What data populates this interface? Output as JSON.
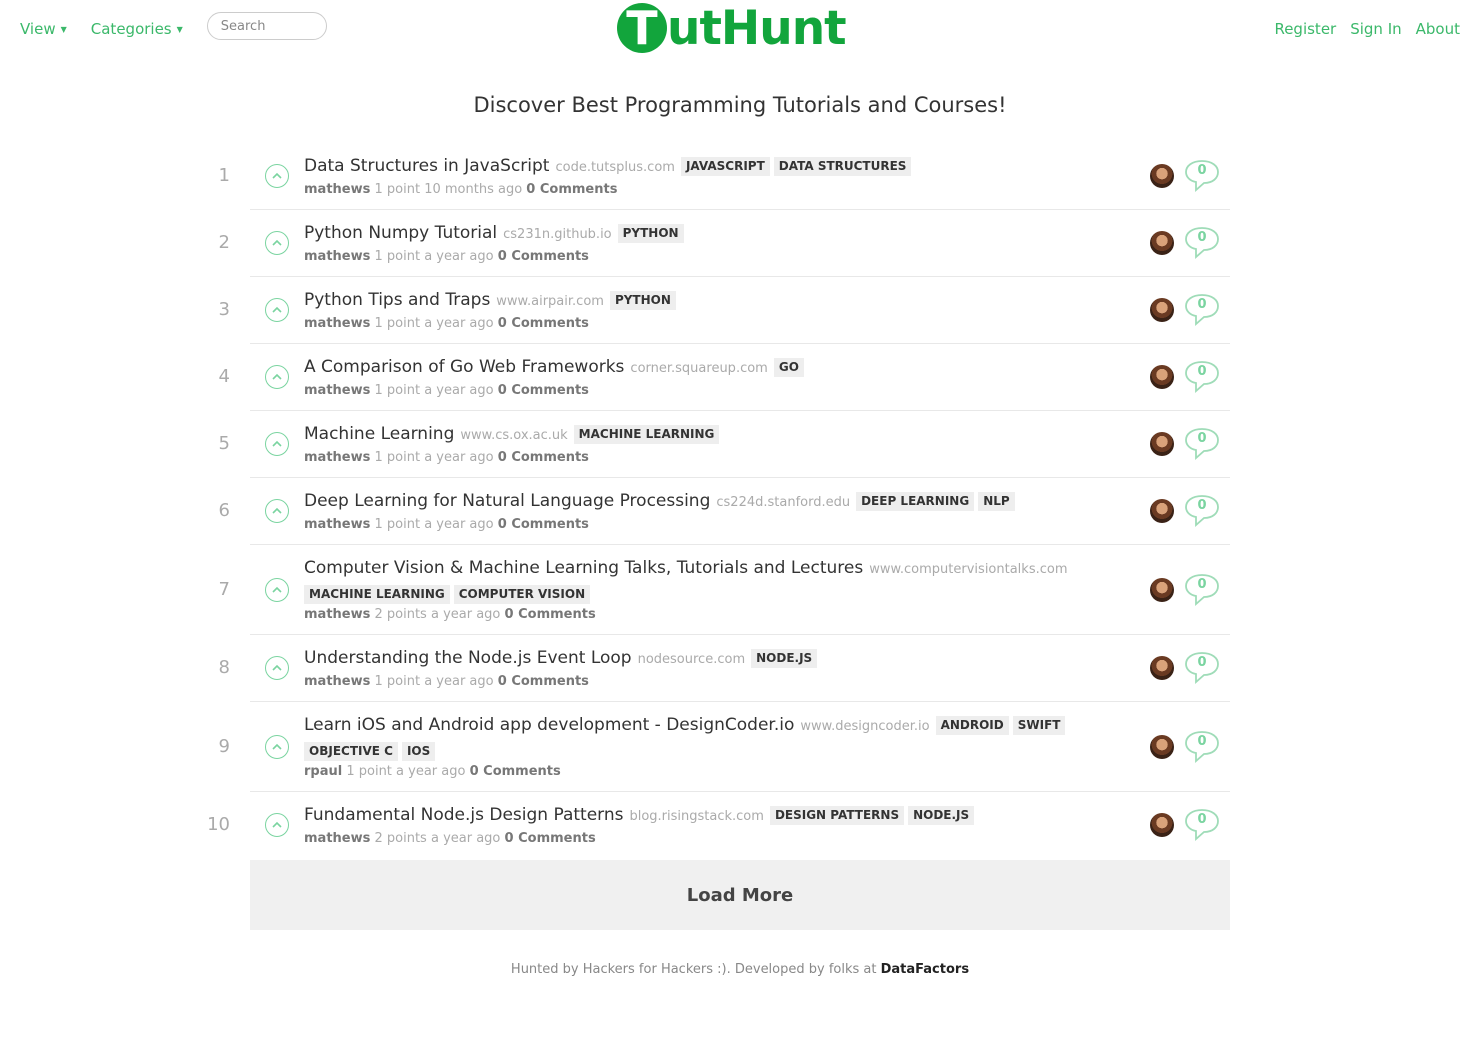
{
  "nav": {
    "view_label": "View",
    "categories_label": "Categories",
    "search_placeholder": "Search",
    "register_label": "Register",
    "signin_label": "Sign In",
    "about_label": "About"
  },
  "logo": {
    "letter": "T",
    "rest": "utHunt"
  },
  "page_title": "Discover Best Programming Tutorials and Courses!",
  "posts": [
    {
      "rank": "1",
      "title": "Data Structures in JavaScript",
      "domain": "code.tutsplus.com",
      "tags": [
        "JAVASCRIPT",
        "DATA STRUCTURES"
      ],
      "author": "mathews",
      "points": "1 point",
      "time": "10 months ago",
      "comments": "0 Comments",
      "comment_count": "0"
    },
    {
      "rank": "2",
      "title": "Python Numpy Tutorial",
      "domain": "cs231n.github.io",
      "tags": [
        "PYTHON"
      ],
      "author": "mathews",
      "points": "1 point",
      "time": "a year ago",
      "comments": "0 Comments",
      "comment_count": "0"
    },
    {
      "rank": "3",
      "title": "Python Tips and Traps",
      "domain": "www.airpair.com",
      "tags": [
        "PYTHON"
      ],
      "author": "mathews",
      "points": "1 point",
      "time": "a year ago",
      "comments": "0 Comments",
      "comment_count": "0"
    },
    {
      "rank": "4",
      "title": "A Comparison of Go Web Frameworks",
      "domain": "corner.squareup.com",
      "tags": [
        "GO"
      ],
      "author": "mathews",
      "points": "1 point",
      "time": "a year ago",
      "comments": "0 Comments",
      "comment_count": "0"
    },
    {
      "rank": "5",
      "title": "Machine Learning",
      "domain": "www.cs.ox.ac.uk",
      "tags": [
        "MACHINE LEARNING"
      ],
      "author": "mathews",
      "points": "1 point",
      "time": "a year ago",
      "comments": "0 Comments",
      "comment_count": "0"
    },
    {
      "rank": "6",
      "title": "Deep Learning for Natural Language Processing",
      "domain": "cs224d.stanford.edu",
      "tags": [
        "DEEP LEARNING",
        "NLP"
      ],
      "author": "mathews",
      "points": "1 point",
      "time": "a year ago",
      "comments": "0 Comments",
      "comment_count": "0"
    },
    {
      "rank": "7",
      "title": "Computer Vision & Machine Learning Talks, Tutorials and Lectures",
      "domain": "www.computervisiontalks.com",
      "tags": [
        "MACHINE LEARNING",
        "COMPUTER VISION"
      ],
      "author": "mathews",
      "points": "2 points",
      "time": "a year ago",
      "comments": "0 Comments",
      "comment_count": "0"
    },
    {
      "rank": "8",
      "title": "Understanding the Node.js Event Loop",
      "domain": "nodesource.com",
      "tags": [
        "NODE.JS"
      ],
      "author": "mathews",
      "points": "1 point",
      "time": "a year ago",
      "comments": "0 Comments",
      "comment_count": "0"
    },
    {
      "rank": "9",
      "title": "Learn iOS and Android app development - DesignCoder.io",
      "domain": "www.designcoder.io",
      "tags": [
        "ANDROID",
        "SWIFT",
        "OBJECTIVE C",
        "IOS"
      ],
      "author": "rpaul",
      "points": "1 point",
      "time": "a year ago",
      "comments": "0 Comments",
      "comment_count": "0"
    },
    {
      "rank": "10",
      "title": "Fundamental Node.js Design Patterns",
      "domain": "blog.risingstack.com",
      "tags": [
        "DESIGN PATTERNS",
        "NODE.JS"
      ],
      "author": "mathews",
      "points": "2 points",
      "time": "a year ago",
      "comments": "0 Comments",
      "comment_count": "0"
    }
  ],
  "load_more_label": "Load More",
  "footer": {
    "text": "Hunted by Hackers for Hackers :). Developed by folks at ",
    "brand": "DataFactors"
  },
  "colors": {
    "accent": "#3bb86a",
    "logo": "#12a53c",
    "muted": "#aaaaaa",
    "tag_bg": "#eeeeee"
  }
}
